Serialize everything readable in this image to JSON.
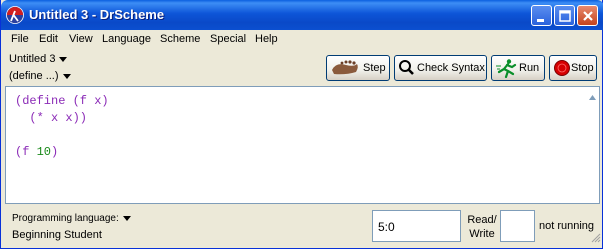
{
  "window": {
    "title": "Untitled 3 - DrScheme",
    "icon": "drscheme-lambda-icon",
    "controls": [
      "minimize-icon",
      "maximize-icon",
      "close-icon"
    ]
  },
  "menu": {
    "file": "File",
    "edit": "Edit",
    "view": "View",
    "language": "Language",
    "scheme": "Scheme",
    "special": "Special",
    "help": "Help"
  },
  "toolbar": {
    "file_name": "Untitled 3",
    "define_menu": "(define ...)",
    "step_label": "Step",
    "check_syntax_label": "Check Syntax",
    "run_label": "Run",
    "stop_label": "Stop"
  },
  "editor": {
    "lines": [
      "(define (f x)",
      "  (* x x))",
      "",
      "(f 10)"
    ]
  },
  "status": {
    "language_label": "Programming language:",
    "language_value": "Beginning Student",
    "position": "5:0",
    "read_label": "Read/",
    "write_label": "Write",
    "run_state": "not running"
  },
  "colors": {
    "titlebar": "#0b55d8",
    "code_text": "#8b2bb7",
    "number": "#1a8a1a"
  }
}
